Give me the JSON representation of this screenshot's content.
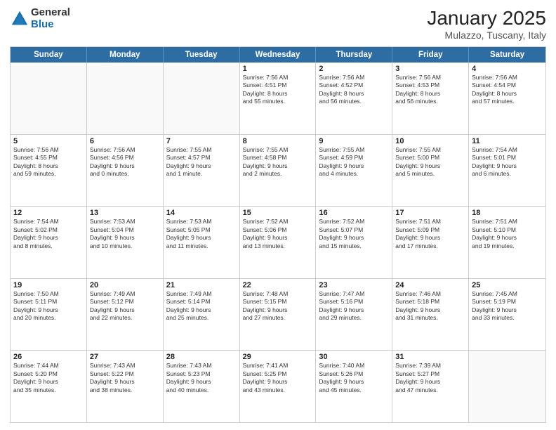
{
  "logo": {
    "general": "General",
    "blue": "Blue"
  },
  "header": {
    "month": "January 2025",
    "location": "Mulazzo, Tuscany, Italy"
  },
  "weekdays": [
    "Sunday",
    "Monday",
    "Tuesday",
    "Wednesday",
    "Thursday",
    "Friday",
    "Saturday"
  ],
  "rows": [
    [
      {
        "day": "",
        "info": ""
      },
      {
        "day": "",
        "info": ""
      },
      {
        "day": "",
        "info": ""
      },
      {
        "day": "1",
        "info": "Sunrise: 7:56 AM\nSunset: 4:51 PM\nDaylight: 8 hours\nand 55 minutes."
      },
      {
        "day": "2",
        "info": "Sunrise: 7:56 AM\nSunset: 4:52 PM\nDaylight: 8 hours\nand 56 minutes."
      },
      {
        "day": "3",
        "info": "Sunrise: 7:56 AM\nSunset: 4:53 PM\nDaylight: 8 hours\nand 56 minutes."
      },
      {
        "day": "4",
        "info": "Sunrise: 7:56 AM\nSunset: 4:54 PM\nDaylight: 8 hours\nand 57 minutes."
      }
    ],
    [
      {
        "day": "5",
        "info": "Sunrise: 7:56 AM\nSunset: 4:55 PM\nDaylight: 8 hours\nand 59 minutes."
      },
      {
        "day": "6",
        "info": "Sunrise: 7:56 AM\nSunset: 4:56 PM\nDaylight: 9 hours\nand 0 minutes."
      },
      {
        "day": "7",
        "info": "Sunrise: 7:55 AM\nSunset: 4:57 PM\nDaylight: 9 hours\nand 1 minute."
      },
      {
        "day": "8",
        "info": "Sunrise: 7:55 AM\nSunset: 4:58 PM\nDaylight: 9 hours\nand 2 minutes."
      },
      {
        "day": "9",
        "info": "Sunrise: 7:55 AM\nSunset: 4:59 PM\nDaylight: 9 hours\nand 4 minutes."
      },
      {
        "day": "10",
        "info": "Sunrise: 7:55 AM\nSunset: 5:00 PM\nDaylight: 9 hours\nand 5 minutes."
      },
      {
        "day": "11",
        "info": "Sunrise: 7:54 AM\nSunset: 5:01 PM\nDaylight: 9 hours\nand 6 minutes."
      }
    ],
    [
      {
        "day": "12",
        "info": "Sunrise: 7:54 AM\nSunset: 5:02 PM\nDaylight: 9 hours\nand 8 minutes."
      },
      {
        "day": "13",
        "info": "Sunrise: 7:53 AM\nSunset: 5:04 PM\nDaylight: 9 hours\nand 10 minutes."
      },
      {
        "day": "14",
        "info": "Sunrise: 7:53 AM\nSunset: 5:05 PM\nDaylight: 9 hours\nand 11 minutes."
      },
      {
        "day": "15",
        "info": "Sunrise: 7:52 AM\nSunset: 5:06 PM\nDaylight: 9 hours\nand 13 minutes."
      },
      {
        "day": "16",
        "info": "Sunrise: 7:52 AM\nSunset: 5:07 PM\nDaylight: 9 hours\nand 15 minutes."
      },
      {
        "day": "17",
        "info": "Sunrise: 7:51 AM\nSunset: 5:09 PM\nDaylight: 9 hours\nand 17 minutes."
      },
      {
        "day": "18",
        "info": "Sunrise: 7:51 AM\nSunset: 5:10 PM\nDaylight: 9 hours\nand 19 minutes."
      }
    ],
    [
      {
        "day": "19",
        "info": "Sunrise: 7:50 AM\nSunset: 5:11 PM\nDaylight: 9 hours\nand 20 minutes."
      },
      {
        "day": "20",
        "info": "Sunrise: 7:49 AM\nSunset: 5:12 PM\nDaylight: 9 hours\nand 22 minutes."
      },
      {
        "day": "21",
        "info": "Sunrise: 7:49 AM\nSunset: 5:14 PM\nDaylight: 9 hours\nand 25 minutes."
      },
      {
        "day": "22",
        "info": "Sunrise: 7:48 AM\nSunset: 5:15 PM\nDaylight: 9 hours\nand 27 minutes."
      },
      {
        "day": "23",
        "info": "Sunrise: 7:47 AM\nSunset: 5:16 PM\nDaylight: 9 hours\nand 29 minutes."
      },
      {
        "day": "24",
        "info": "Sunrise: 7:46 AM\nSunset: 5:18 PM\nDaylight: 9 hours\nand 31 minutes."
      },
      {
        "day": "25",
        "info": "Sunrise: 7:45 AM\nSunset: 5:19 PM\nDaylight: 9 hours\nand 33 minutes."
      }
    ],
    [
      {
        "day": "26",
        "info": "Sunrise: 7:44 AM\nSunset: 5:20 PM\nDaylight: 9 hours\nand 35 minutes."
      },
      {
        "day": "27",
        "info": "Sunrise: 7:43 AM\nSunset: 5:22 PM\nDaylight: 9 hours\nand 38 minutes."
      },
      {
        "day": "28",
        "info": "Sunrise: 7:43 AM\nSunset: 5:23 PM\nDaylight: 9 hours\nand 40 minutes."
      },
      {
        "day": "29",
        "info": "Sunrise: 7:41 AM\nSunset: 5:25 PM\nDaylight: 9 hours\nand 43 minutes."
      },
      {
        "day": "30",
        "info": "Sunrise: 7:40 AM\nSunset: 5:26 PM\nDaylight: 9 hours\nand 45 minutes."
      },
      {
        "day": "31",
        "info": "Sunrise: 7:39 AM\nSunset: 5:27 PM\nDaylight: 9 hours\nand 47 minutes."
      },
      {
        "day": "",
        "info": ""
      }
    ]
  ]
}
